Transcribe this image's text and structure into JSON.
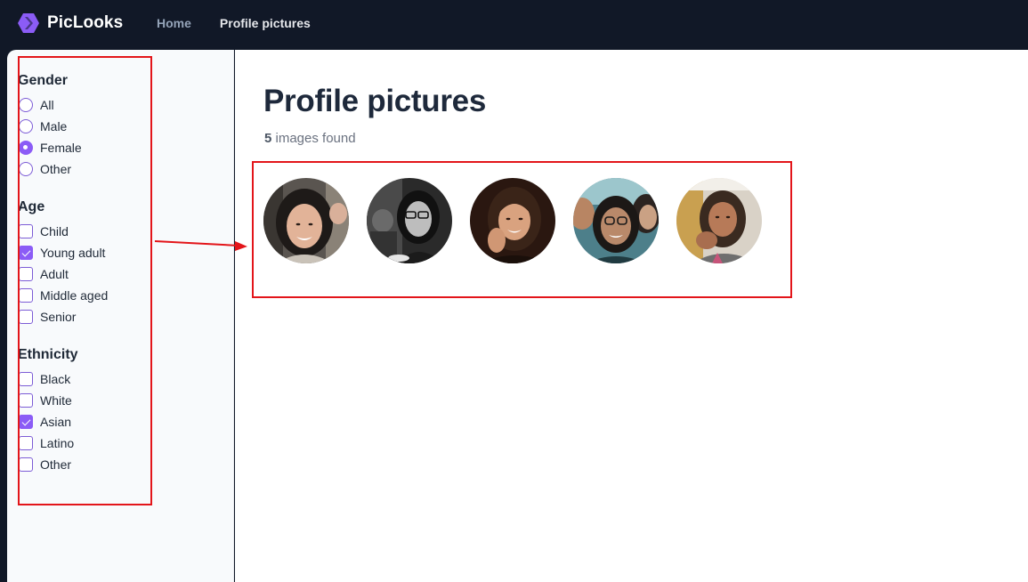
{
  "app": {
    "name": "PicLooks"
  },
  "nav": {
    "items": [
      {
        "label": "Home"
      },
      {
        "label": "Profile pictures"
      }
    ]
  },
  "filters": {
    "gender": {
      "title": "Gender",
      "options": [
        {
          "label": "All",
          "checked": false
        },
        {
          "label": "Male",
          "checked": false
        },
        {
          "label": "Female",
          "checked": true
        },
        {
          "label": "Other",
          "checked": false
        }
      ]
    },
    "age": {
      "title": "Age",
      "options": [
        {
          "label": "Child",
          "checked": false
        },
        {
          "label": "Young adult",
          "checked": true
        },
        {
          "label": "Adult",
          "checked": false
        },
        {
          "label": "Middle aged",
          "checked": false
        },
        {
          "label": "Senior",
          "checked": false
        }
      ]
    },
    "ethnicity": {
      "title": "Ethnicity",
      "options": [
        {
          "label": "Black",
          "checked": false
        },
        {
          "label": "White",
          "checked": false
        },
        {
          "label": "Asian",
          "checked": true
        },
        {
          "label": "Latino",
          "checked": false
        },
        {
          "label": "Other",
          "checked": false
        }
      ]
    }
  },
  "main": {
    "title": "Profile pictures",
    "count": "5",
    "count_suffix": " images found"
  },
  "colors": {
    "nav_bg": "#111827",
    "accent": "#8b5cf6",
    "annotation": "#e3151a"
  }
}
